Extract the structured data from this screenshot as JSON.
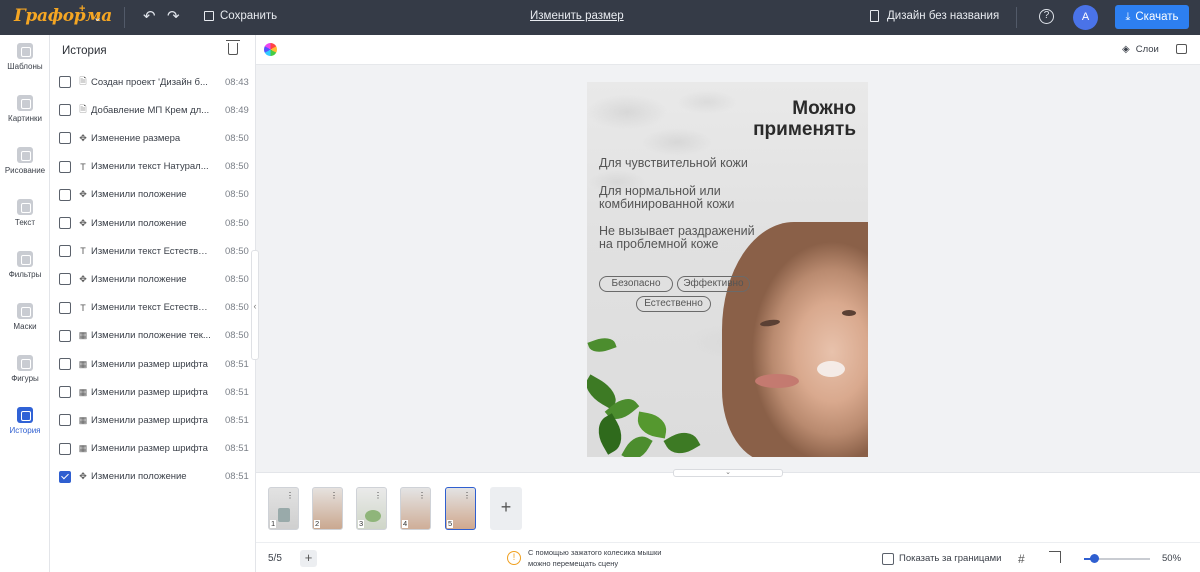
{
  "topbar": {
    "logo": "Граформа",
    "save_label": "Сохранить",
    "resize_label": "Изменить размер",
    "doc_name": "Дизайн без названия",
    "avatar_letter": "A",
    "download_label": "Скачать"
  },
  "leftnav": {
    "items": [
      {
        "label": "Шаблоны",
        "icon": "templates-icon"
      },
      {
        "label": "Картинки",
        "icon": "images-icon"
      },
      {
        "label": "Рисование",
        "icon": "drawing-icon"
      },
      {
        "label": "Текст",
        "icon": "text-icon"
      },
      {
        "label": "Фильтры",
        "icon": "filters-icon"
      },
      {
        "label": "Маски",
        "icon": "masks-icon"
      },
      {
        "label": "Фигуры",
        "icon": "shapes-icon"
      },
      {
        "label": "История",
        "icon": "history-icon",
        "active": true
      }
    ]
  },
  "history": {
    "title": "История",
    "rows": [
      {
        "icon": "doc",
        "label": "Создан проект 'Дизайн б...",
        "time": "08:43",
        "checked": false
      },
      {
        "icon": "doc",
        "label": "Добавление МП Крем дл...",
        "time": "08:49",
        "checked": false
      },
      {
        "icon": "move",
        "label": "Изменение размера",
        "time": "08:50",
        "checked": false
      },
      {
        "icon": "text",
        "label": "Изменили текст Натурал...",
        "time": "08:50",
        "checked": false
      },
      {
        "icon": "move",
        "label": "Изменили положение",
        "time": "08:50",
        "checked": false
      },
      {
        "icon": "move",
        "label": "Изменили положение",
        "time": "08:50",
        "checked": false
      },
      {
        "icon": "text",
        "label": "Изменили текст Естестве...",
        "time": "08:50",
        "checked": false
      },
      {
        "icon": "move",
        "label": "Изменили положение",
        "time": "08:50",
        "checked": false
      },
      {
        "icon": "text",
        "label": "Изменили текст Естестве...",
        "time": "08:50",
        "checked": false
      },
      {
        "icon": "pattern",
        "label": "Изменили положение тек...",
        "time": "08:50",
        "checked": false
      },
      {
        "icon": "pattern",
        "label": "Изменили размер шрифта",
        "time": "08:51",
        "checked": false
      },
      {
        "icon": "pattern",
        "label": "Изменили размер шрифта",
        "time": "08:51",
        "checked": false
      },
      {
        "icon": "pattern",
        "label": "Изменили размер шрифта",
        "time": "08:51",
        "checked": false
      },
      {
        "icon": "pattern",
        "label": "Изменили размер шрифта",
        "time": "08:51",
        "checked": false
      },
      {
        "icon": "move",
        "label": "Изменили положение",
        "time": "08:51",
        "checked": true
      }
    ]
  },
  "subbar": {
    "layers_label": "Слои"
  },
  "canvas": {
    "title_line1": "Можно",
    "title_line2": "применять",
    "line1": "Для чувствительной кожи",
    "line2a": "Для нормальной или",
    "line2b": "комбинированной кожи",
    "line3a": "Не вызывает раздражений",
    "line3b": "на проблемной коже",
    "chip1": "Безопасно",
    "chip2": "Эффективно",
    "chip3": "Естественно"
  },
  "pages": {
    "thumbs": [
      "1",
      "2",
      "3",
      "4",
      "5"
    ],
    "active": 5
  },
  "status": {
    "counter": "5/5",
    "hint_line1": "С помощью зажатого колесика мышки",
    "hint_line2": "можно перемещать сцену",
    "show_outside": "Показать за границами",
    "zoom": "50%",
    "zoom_value": 0.12
  }
}
